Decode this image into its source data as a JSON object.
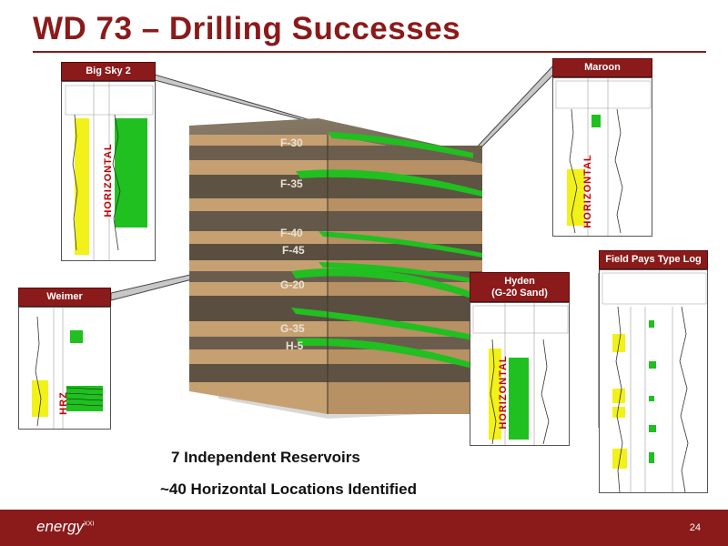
{
  "title": "WD 73 – Drilling Successes",
  "panels": {
    "big_sky": {
      "title": "Big Sky 2",
      "vertical_label": "HORIZONTAL"
    },
    "maroon": {
      "title": "Maroon",
      "vertical_label": "HORIZONTAL"
    },
    "weimer": {
      "title": "Weimer",
      "vertical_label": "HRZ"
    },
    "hyden": {
      "title_line1": "Hyden",
      "title_line2": "(G-20 Sand)",
      "vertical_label": "HORIZONTAL"
    },
    "field_pays": {
      "title": "Field Pays Type Log"
    }
  },
  "diagram": {
    "layers": [
      "F-30",
      "F-35",
      "F-40",
      "F-45",
      "G-20",
      "G-35",
      "H-5"
    ]
  },
  "captions": {
    "line1": "7 Independent Reservoirs",
    "line2": "~40 Horizontal Locations Identified"
  },
  "footer": {
    "logo_text": "energy",
    "logo_super": "XXI",
    "page_number": "24"
  },
  "colors": {
    "brand": "#8b1a1a",
    "pay_green": "#1fc01f",
    "log_yellow": "#f2f21a",
    "label_red": "#c00000"
  }
}
